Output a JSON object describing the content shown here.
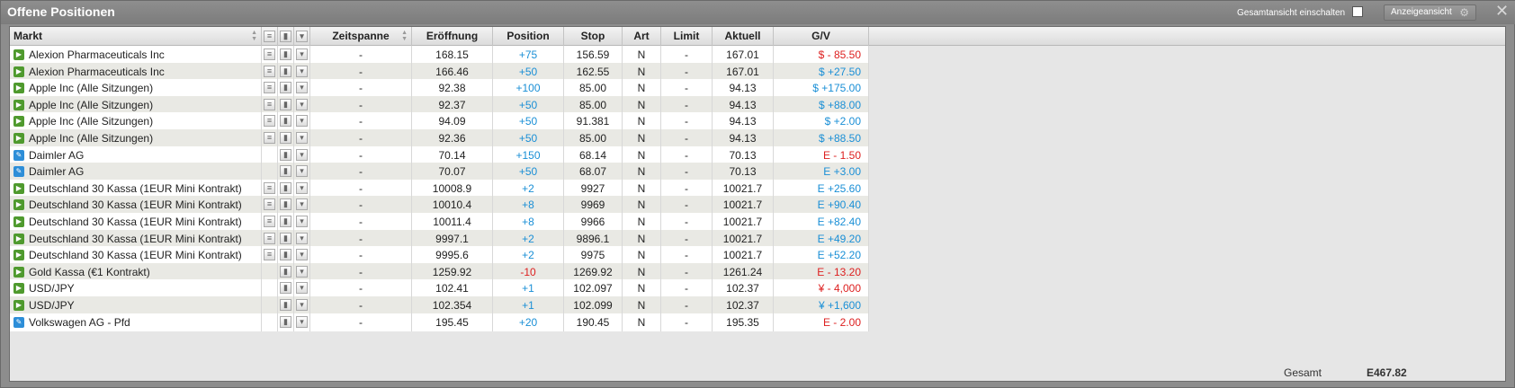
{
  "window": {
    "title": "Offene Positionen",
    "gesamt_toggle_label": "Gesamtansicht einschalten",
    "view_button_label": "Anzeigeansicht",
    "close_symbol": "✕"
  },
  "columns": {
    "market": "Markt",
    "timespan": "Zeitspanne",
    "opening": "Eröffnung",
    "position": "Position",
    "stop": "Stop",
    "type": "Art",
    "limit": "Limit",
    "current": "Aktuell",
    "pnl": "G/V"
  },
  "rows": [
    {
      "marker": "order",
      "market": "Alexion Pharmaceuticals Inc",
      "info": true,
      "timespan": "-",
      "opening": "168.15",
      "position": "+75",
      "stop": "156.59",
      "type": "N",
      "limit": "-",
      "current": "167.01",
      "pnl": "$ - 85.50",
      "pnl_sign": "neg",
      "pos_sign": "pos"
    },
    {
      "marker": "order",
      "market": "Alexion Pharmaceuticals Inc",
      "info": true,
      "timespan": "-",
      "opening": "166.46",
      "position": "+50",
      "stop": "162.55",
      "type": "N",
      "limit": "-",
      "current": "167.01",
      "pnl": "$ +27.50",
      "pnl_sign": "pos",
      "pos_sign": "pos"
    },
    {
      "marker": "order",
      "market": "Apple Inc (Alle Sitzungen)",
      "info": true,
      "timespan": "-",
      "opening": "92.38",
      "position": "+100",
      "stop": "85.00",
      "type": "N",
      "limit": "-",
      "current": "94.13",
      "pnl": "$ +175.00",
      "pnl_sign": "pos",
      "pos_sign": "pos"
    },
    {
      "marker": "order",
      "market": "Apple Inc (Alle Sitzungen)",
      "info": true,
      "timespan": "-",
      "opening": "92.37",
      "position": "+50",
      "stop": "85.00",
      "type": "N",
      "limit": "-",
      "current": "94.13",
      "pnl": "$ +88.00",
      "pnl_sign": "pos",
      "pos_sign": "pos"
    },
    {
      "marker": "order",
      "market": "Apple Inc (Alle Sitzungen)",
      "info": true,
      "timespan": "-",
      "opening": "94.09",
      "position": "+50",
      "stop": "91.381",
      "type": "N",
      "limit": "-",
      "current": "94.13",
      "pnl": "$ +2.00",
      "pnl_sign": "pos",
      "pos_sign": "pos"
    },
    {
      "marker": "order",
      "market": "Apple Inc (Alle Sitzungen)",
      "info": true,
      "timespan": "-",
      "opening": "92.36",
      "position": "+50",
      "stop": "85.00",
      "type": "N",
      "limit": "-",
      "current": "94.13",
      "pnl": "$ +88.50",
      "pnl_sign": "pos",
      "pos_sign": "pos"
    },
    {
      "marker": "edit",
      "market": "Daimler AG",
      "info": false,
      "timespan": "-",
      "opening": "70.14",
      "position": "+150",
      "stop": "68.14",
      "type": "N",
      "limit": "-",
      "current": "70.13",
      "pnl": "E - 1.50",
      "pnl_sign": "neg",
      "pos_sign": "pos"
    },
    {
      "marker": "edit",
      "market": "Daimler AG",
      "info": false,
      "timespan": "-",
      "opening": "70.07",
      "position": "+50",
      "stop": "68.07",
      "type": "N",
      "limit": "-",
      "current": "70.13",
      "pnl": "E +3.00",
      "pnl_sign": "pos",
      "pos_sign": "pos"
    },
    {
      "marker": "order",
      "market": "Deutschland 30 Kassa (1EUR Mini Kontrakt)",
      "info": true,
      "timespan": "-",
      "opening": "10008.9",
      "position": "+2",
      "stop": "9927",
      "type": "N",
      "limit": "-",
      "current": "10021.7",
      "pnl": "E +25.60",
      "pnl_sign": "pos",
      "pos_sign": "pos"
    },
    {
      "marker": "order",
      "market": "Deutschland 30 Kassa (1EUR Mini Kontrakt)",
      "info": true,
      "timespan": "-",
      "opening": "10010.4",
      "position": "+8",
      "stop": "9969",
      "type": "N",
      "limit": "-",
      "current": "10021.7",
      "pnl": "E +90.40",
      "pnl_sign": "pos",
      "pos_sign": "pos"
    },
    {
      "marker": "order",
      "market": "Deutschland 30 Kassa (1EUR Mini Kontrakt)",
      "info": true,
      "timespan": "-",
      "opening": "10011.4",
      "position": "+8",
      "stop": "9966",
      "type": "N",
      "limit": "-",
      "current": "10021.7",
      "pnl": "E +82.40",
      "pnl_sign": "pos",
      "pos_sign": "pos"
    },
    {
      "marker": "order",
      "market": "Deutschland 30 Kassa (1EUR Mini Kontrakt)",
      "info": true,
      "timespan": "-",
      "opening": "9997.1",
      "position": "+2",
      "stop": "9896.1",
      "type": "N",
      "limit": "-",
      "current": "10021.7",
      "pnl": "E +49.20",
      "pnl_sign": "pos",
      "pos_sign": "pos"
    },
    {
      "marker": "order",
      "market": "Deutschland 30 Kassa (1EUR Mini Kontrakt)",
      "info": true,
      "timespan": "-",
      "opening": "9995.6",
      "position": "+2",
      "stop": "9975",
      "type": "N",
      "limit": "-",
      "current": "10021.7",
      "pnl": "E +52.20",
      "pnl_sign": "pos",
      "pos_sign": "pos"
    },
    {
      "marker": "order",
      "market": "Gold Kassa (€1 Kontrakt)",
      "info": false,
      "timespan": "-",
      "opening": "1259.92",
      "position": "-10",
      "stop": "1269.92",
      "type": "N",
      "limit": "-",
      "current": "1261.24",
      "pnl": "E - 13.20",
      "pnl_sign": "neg",
      "pos_sign": "neg"
    },
    {
      "marker": "order",
      "market": "USD/JPY",
      "info": false,
      "timespan": "-",
      "opening": "102.41",
      "position": "+1",
      "stop": "102.097",
      "type": "N",
      "limit": "-",
      "current": "102.37",
      "pnl": "¥ - 4,000",
      "pnl_sign": "neg",
      "pos_sign": "pos"
    },
    {
      "marker": "order",
      "market": "USD/JPY",
      "info": false,
      "timespan": "-",
      "opening": "102.354",
      "position": "+1",
      "stop": "102.099",
      "type": "N",
      "limit": "-",
      "current": "102.37",
      "pnl": "¥ +1,600",
      "pnl_sign": "pos",
      "pos_sign": "pos"
    },
    {
      "marker": "edit",
      "market": "Volkswagen AG - Pfd",
      "info": false,
      "timespan": "-",
      "opening": "195.45",
      "position": "+20",
      "stop": "190.45",
      "type": "N",
      "limit": "-",
      "current": "195.35",
      "pnl": "E - 2.00",
      "pnl_sign": "neg",
      "pos_sign": "pos"
    }
  ],
  "footer": {
    "total_label": "Gesamt",
    "total_value": "E467.82"
  },
  "colors": {
    "positive": "#1a8fd6",
    "negative": "#dd2020",
    "order_marker": "#4f9a2e",
    "edit_marker": "#2d8ed8"
  }
}
